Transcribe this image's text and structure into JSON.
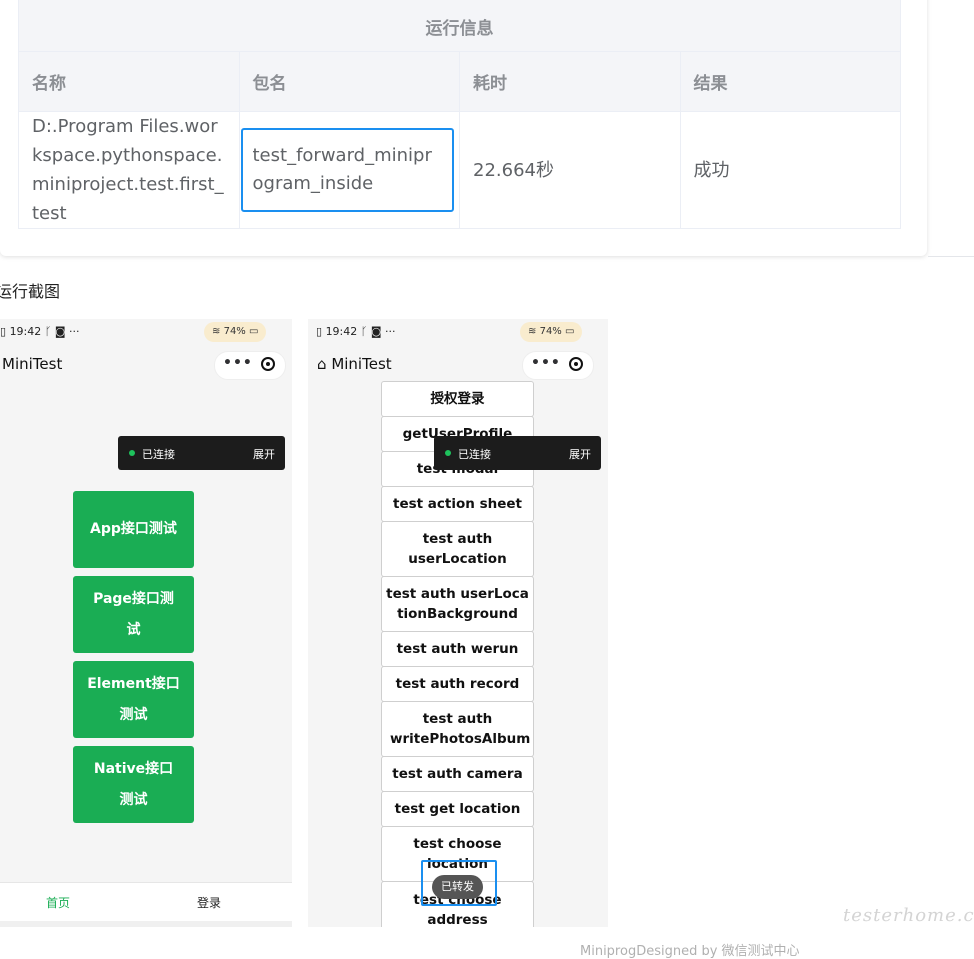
{
  "report": {
    "caption": "运行信息",
    "headers": [
      "名称",
      "包名",
      "耗时",
      "结果"
    ],
    "row": {
      "name": "D:.Program Files.workspace.pythonspace.miniproject.test.first_test",
      "package": "test_forward_miniprogram_inside",
      "duration": "22.664秒",
      "result": "成功"
    }
  },
  "screenshots_label": "运行截图",
  "phone1": {
    "time": "19:42",
    "status_icons": "ᚴ ◙ ···",
    "battery": "74%",
    "title": "MiniTest",
    "capsule_dots": "•••",
    "connection": {
      "status": "已连接",
      "expand": "展开"
    },
    "buttons": [
      "App接口测试",
      "Page接口测试",
      "Element接口测试",
      "Native接口测试"
    ],
    "tabs": [
      "首页",
      "登录"
    ]
  },
  "phone2": {
    "time": "19:42",
    "status_icons": "ᚴ ◙ ···",
    "battery": "74%",
    "title": "MiniTest",
    "capsule_dots": "•••",
    "connection": {
      "status": "已连接",
      "expand": "展开"
    },
    "items": [
      "授权登录",
      "getUserProfile",
      "test modal",
      "test action sheet",
      "test auth userLocation",
      "test auth userLocationBackground",
      "test auth werun",
      "test auth record",
      "test auth writePhotosAlbum",
      "test auth camera",
      "test get location",
      "test choose location",
      "test choose address"
    ],
    "toast": "已转发"
  },
  "watermark": "testerhome.com",
  "footer": "MiniprogDesigned by 微信测试中心"
}
